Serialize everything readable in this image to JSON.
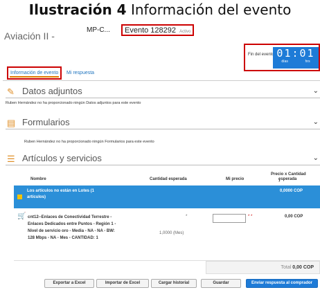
{
  "caption": {
    "bold": "Ilustración 4",
    "rest": "Información del evento"
  },
  "header": {
    "crumb_start": "Aviación II -",
    "crumb_mid": "MP-C...",
    "event_title": "Evento 128292",
    "status": "Activo"
  },
  "timer": {
    "label": "Fin del evento",
    "digits": "01:01",
    "unit_days": "días",
    "unit_hours": "hrs"
  },
  "tabs": [
    {
      "label": "Información de evento"
    },
    {
      "label": "Mi respuesta"
    }
  ],
  "sections": {
    "attachments": {
      "title": "Datos adjuntos",
      "note": "Ruben Hernández no ha proporcionado ningún Datos adjuntos para este evento"
    },
    "forms": {
      "title": "Formularios",
      "note": "Ruben Hernández no ha proporcionado ningún Formularios para este evento"
    },
    "items": {
      "title": "Artículos y servicios"
    }
  },
  "table": {
    "headers": {
      "name": "Nombre",
      "qty": "Cantidad esperada",
      "price": "Mi precio",
      "total_line1": "Precio x Cantidad",
      "total_line2": "esperada"
    },
    "lot_row": {
      "text": "Los artículos no están en Lotes (1 artículos)",
      "amount": "0,0000 COP"
    },
    "item": {
      "description": "cnt12--Enlaces de Conectividad Terrestre - Enlaces Dedicados entre Puntos - Región 1 - Nivel de servicio oro - Media - NA - NA - BW: 128 Mbps - NA - Mes - CANTIDAD: 1",
      "qty_star": "*",
      "qty": "1,0000 (Mes)",
      "price_value": "",
      "price_star": "* *",
      "amount": "0,00 COP"
    },
    "total": {
      "label": "Total",
      "value": "0,00 COP"
    }
  },
  "buttons": {
    "export": "Exportar a Excel",
    "import": "Importar de Excel",
    "history": "Cargar historial",
    "save": "Guardar",
    "submit": "Enviar respuesta al comprador"
  }
}
